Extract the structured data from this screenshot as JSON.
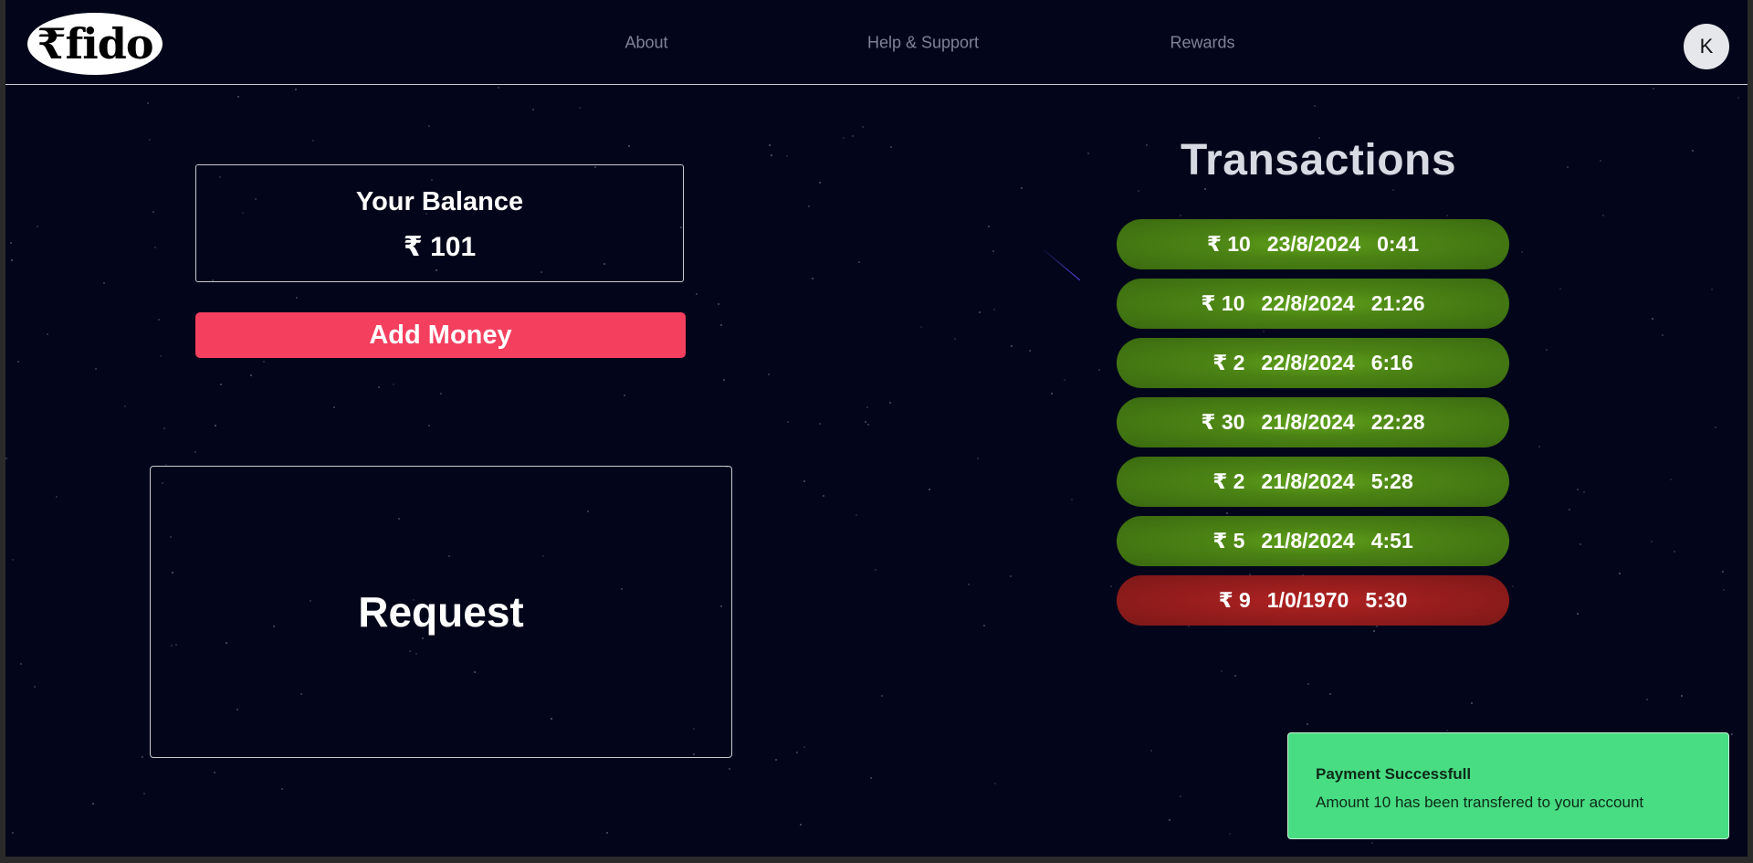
{
  "header": {
    "logo_text": "₹fido",
    "nav": [
      {
        "label": "About"
      },
      {
        "label": "Help & Support"
      },
      {
        "label": "Rewards"
      }
    ],
    "avatar_initial": "K"
  },
  "balance": {
    "title": "Your Balance",
    "amount": "₹ 101"
  },
  "add_money_label": "Add Money",
  "request_label": "Request",
  "transactions": {
    "title": "Transactions",
    "items": [
      {
        "amount": "₹ 10",
        "date": "23/8/2024",
        "time": "0:41",
        "status": "success"
      },
      {
        "amount": "₹ 10",
        "date": "22/8/2024",
        "time": "21:26",
        "status": "success"
      },
      {
        "amount": "₹ 2",
        "date": "22/8/2024",
        "time": "6:16",
        "status": "success"
      },
      {
        "amount": "₹ 30",
        "date": "21/8/2024",
        "time": "22:28",
        "status": "success"
      },
      {
        "amount": "₹ 2",
        "date": "21/8/2024",
        "time": "5:28",
        "status": "success"
      },
      {
        "amount": "₹ 5",
        "date": "21/8/2024",
        "time": "4:51",
        "status": "success"
      },
      {
        "amount": "₹ 9",
        "date": "1/0/1970",
        "time": "5:30",
        "status": "failed"
      }
    ]
  },
  "toast": {
    "title": "Payment Successfull",
    "message": "Amount 10 has been transfered to your account"
  },
  "colors": {
    "background": "#03061a",
    "add_money": "#f43f5e",
    "success_row": "#4b8214",
    "failed_row": "#981d1d",
    "toast": "#48dc83"
  }
}
